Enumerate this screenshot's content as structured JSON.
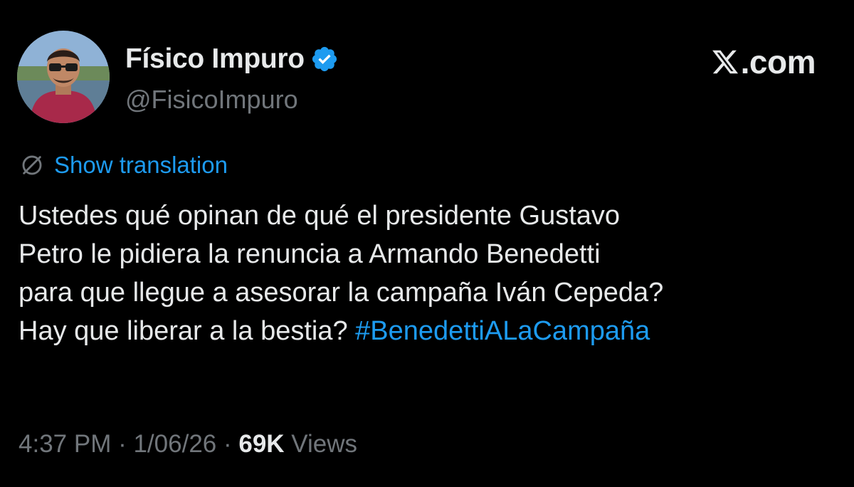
{
  "author": {
    "display_name": "Físico Impuro",
    "handle": "@FisicoImpuro",
    "verified_icon": "verified-badge-icon",
    "avatar_icon": "avatar-photo"
  },
  "brand": {
    "text": ".com",
    "icon": "x-logo-icon"
  },
  "translate": {
    "icon": "globe-slash-icon",
    "label": "Show translation"
  },
  "tweet": {
    "lines": [
      "Ustedes qué opinan de qué el presidente Gustavo",
      "Petro le pidiera la renuncia a Armando Benedetti",
      "para que llegue a asesorar la campaña Iván Cepeda?"
    ],
    "last_line_text": "Hay que liberar a la bestia? ",
    "hashtag": "#BenedettiALaCampaña"
  },
  "meta": {
    "time": "4:37 PM",
    "separator": " · ",
    "date": "1/06/26",
    "views_count": "69K",
    "views_label": " Views"
  },
  "colors": {
    "background": "#000000",
    "text": "#e7e9ea",
    "secondary": "#71767b",
    "accent": "#1d9bf0"
  }
}
